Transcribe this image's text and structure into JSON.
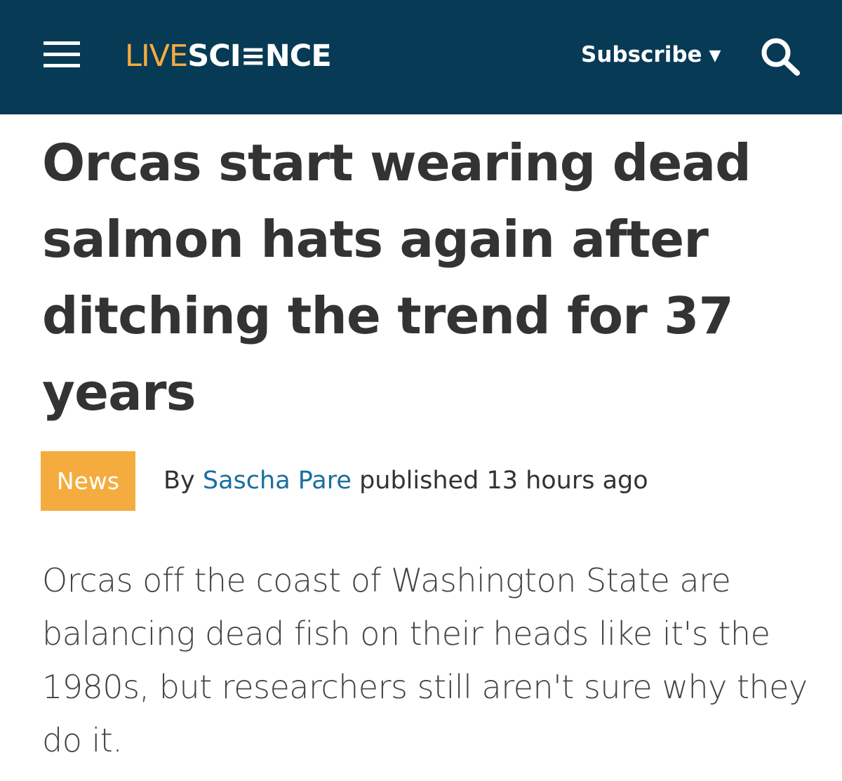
{
  "header": {
    "menu_icon": "hamburger-menu-icon",
    "logo_part1": "LIVE",
    "logo_part2": "SCI≡NCE",
    "subscribe_label": "Subscribe",
    "subscribe_caret": "▼",
    "search_icon": "search-icon",
    "background_color": "#073a55",
    "accent_color": "#f5ac3f"
  },
  "article": {
    "headline": "Orcas start wearing dead salmon hats again after ditching the trend for 37 years",
    "category": "News",
    "byline_prefix": "By",
    "author": "Sascha Pare",
    "published_text": "published 13 hours ago",
    "standfirst": "Orcas off the coast of Washington State are balancing dead fish on their heads like it's the 1980s, but researchers still aren't sure why they do it.",
    "author_link_color": "#1a6fa0"
  }
}
